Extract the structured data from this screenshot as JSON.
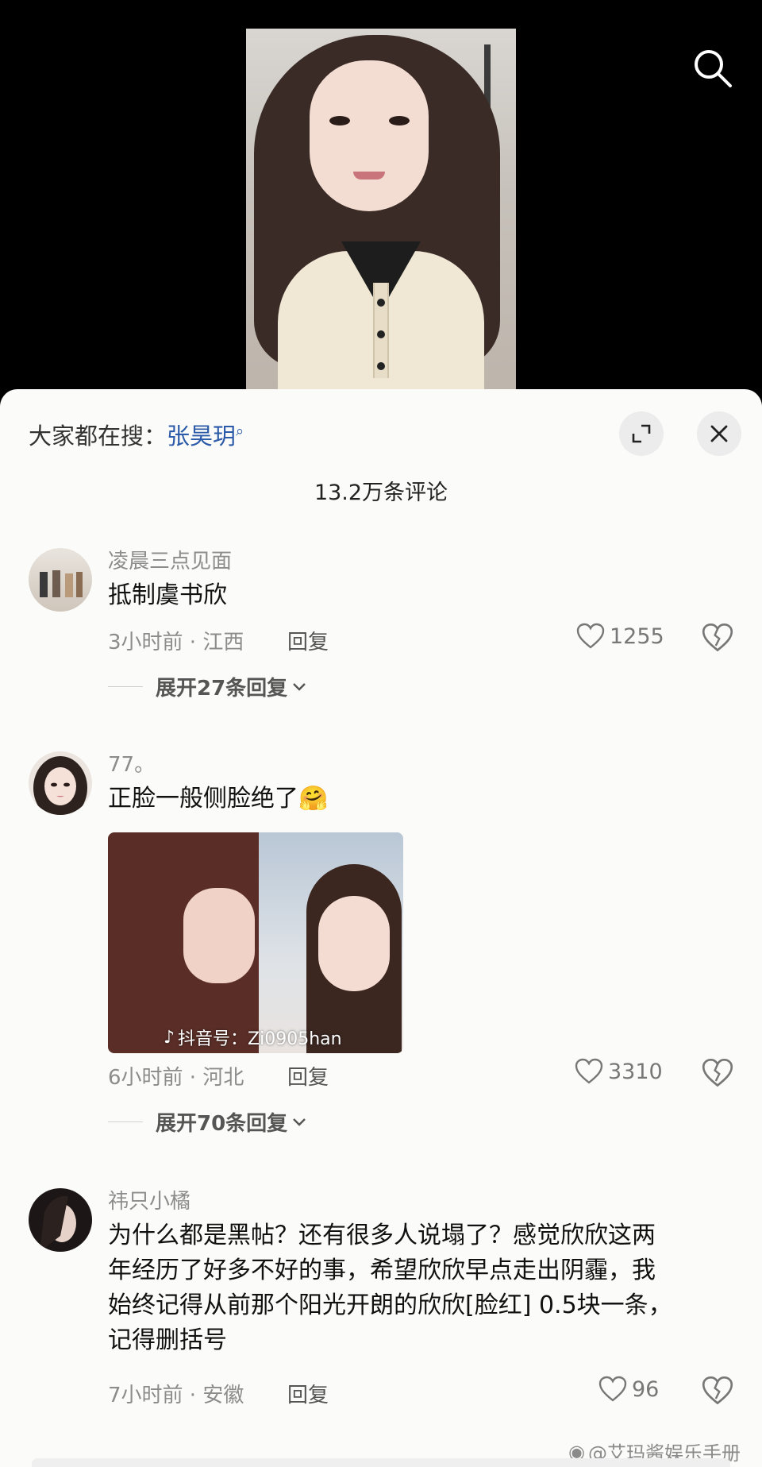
{
  "hot_search": {
    "prefix": "大家都在搜：",
    "keyword": "张昊玥"
  },
  "comment_count_title": "13.2万条评论",
  "comments": [
    {
      "username": "凌晨三点见面",
      "text": "抵制虞书欣",
      "meta": "3小时前 · 江西",
      "reply_label": "回复",
      "likes": "1255",
      "expand_label": "展开27条回复"
    },
    {
      "username": "77。",
      "text": "正脸一般侧脸绝了🤗",
      "media_watermark": "抖音号：Zi0905han",
      "meta": "6小时前 · 河北",
      "reply_label": "回复",
      "likes": "3310",
      "expand_label": "展开70条回复"
    },
    {
      "username": "祎只小橘",
      "text_lines": [
        "为什么都是黑帖？还有很多人说塌了？感觉欣欣这两",
        "年经历了好多不好的事，希望欣欣早点走出阴霾，我",
        "始终记得从前那个阳光开朗的欣欣[脸红] 0.5块一条，",
        "记得删括号"
      ],
      "meta": "7小时前 · 安徽",
      "reply_label": "回复",
      "likes": "96"
    }
  ],
  "watermark_text": "@艾玛酱娱乐手册",
  "colors": {
    "sheet_bg": "#fbfbf9",
    "link_blue": "#2a5aa8",
    "meta_gray": "#8c8c8c"
  }
}
